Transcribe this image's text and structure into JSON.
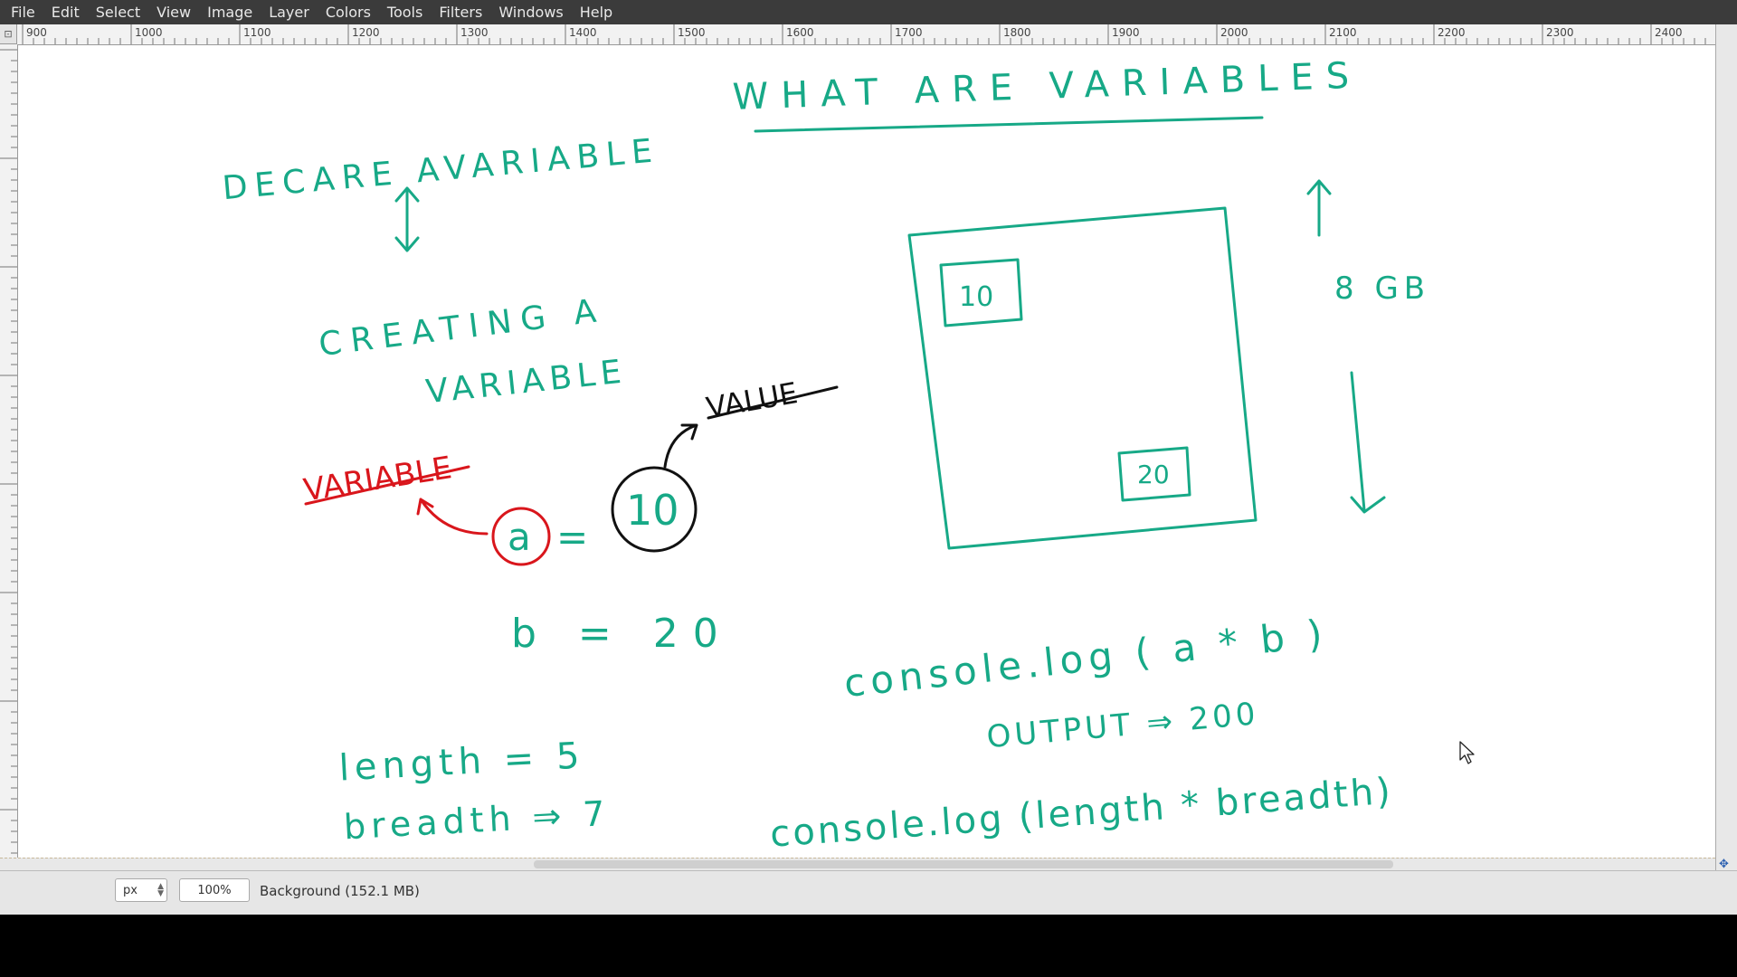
{
  "menu": [
    "File",
    "Edit",
    "Select",
    "View",
    "Image",
    "Layer",
    "Colors",
    "Tools",
    "Filters",
    "Windows",
    "Help"
  ],
  "ruler": {
    "labels": [
      "900",
      "1000",
      "1100",
      "1200",
      "1300",
      "1400",
      "1500",
      "1600",
      "1700",
      "1800",
      "1900",
      "2000",
      "2100",
      "2200",
      "2300",
      "2400"
    ]
  },
  "status": {
    "unit": "px",
    "zoom": "100%",
    "layer": "Background (152.1 MB)"
  },
  "drawing": {
    "title": "WHAT ARE VARIABLES",
    "declare": "DECARE AVARIABLE",
    "creating_line1": "CREATING A",
    "creating_line2": "VARIABLE",
    "variable_label": "VARIABLE",
    "value_label": "VALUE",
    "var_a": "a",
    "equals": "=",
    "val_10": "10",
    "b_assign": "b = 20",
    "box_10": "10",
    "box_20": "20",
    "memory_size": "8 GB",
    "console_ab": "console.log ( a * b )",
    "output": "OUTPUT ⇒ 200",
    "length_assign": "length = 5",
    "breadth_assign": "breadth ⇒ 7",
    "console_lb": "console.log (length * breadth)"
  },
  "colors": {
    "green": "#17a987",
    "red": "#d9161c",
    "black": "#111111"
  }
}
